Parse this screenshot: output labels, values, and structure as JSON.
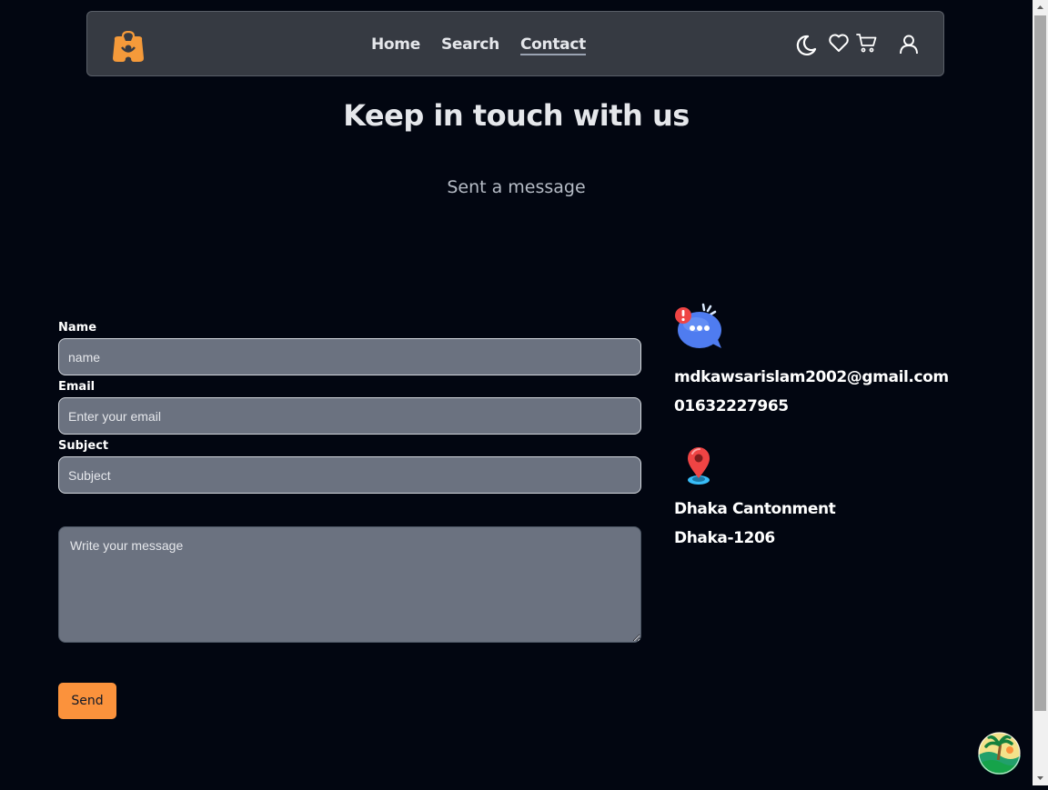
{
  "nav": {
    "logo_icon": "shopping-bag-logo-icon",
    "links": [
      {
        "label": "Home"
      },
      {
        "label": "Search"
      },
      {
        "label": "Contact"
      }
    ],
    "icons": [
      "moon-icon",
      "heart-icon",
      "cart-icon",
      "user-icon"
    ]
  },
  "page": {
    "title": "Keep in touch with us",
    "subtitle": "Sent a message"
  },
  "form": {
    "name_label": "Name",
    "name_placeholder": "name",
    "email_label": "Email",
    "email_placeholder": "Enter your email",
    "subject_label": "Subject",
    "subject_placeholder": "Subject",
    "message_placeholder": "Write your message",
    "send_label": "Send"
  },
  "contact": {
    "message_icon": "chat-bubble-icon",
    "email": "mdkawsarislam2002@gmail.com",
    "phone": "01632227965",
    "location_icon": "map-pin-icon",
    "address_line1": "Dhaka Cantonment",
    "address_line2": "Dhaka-1206"
  },
  "colors": {
    "background": "#020611",
    "navbar": "#363a42",
    "accent": "#fb923c",
    "input": "#6b7280"
  }
}
